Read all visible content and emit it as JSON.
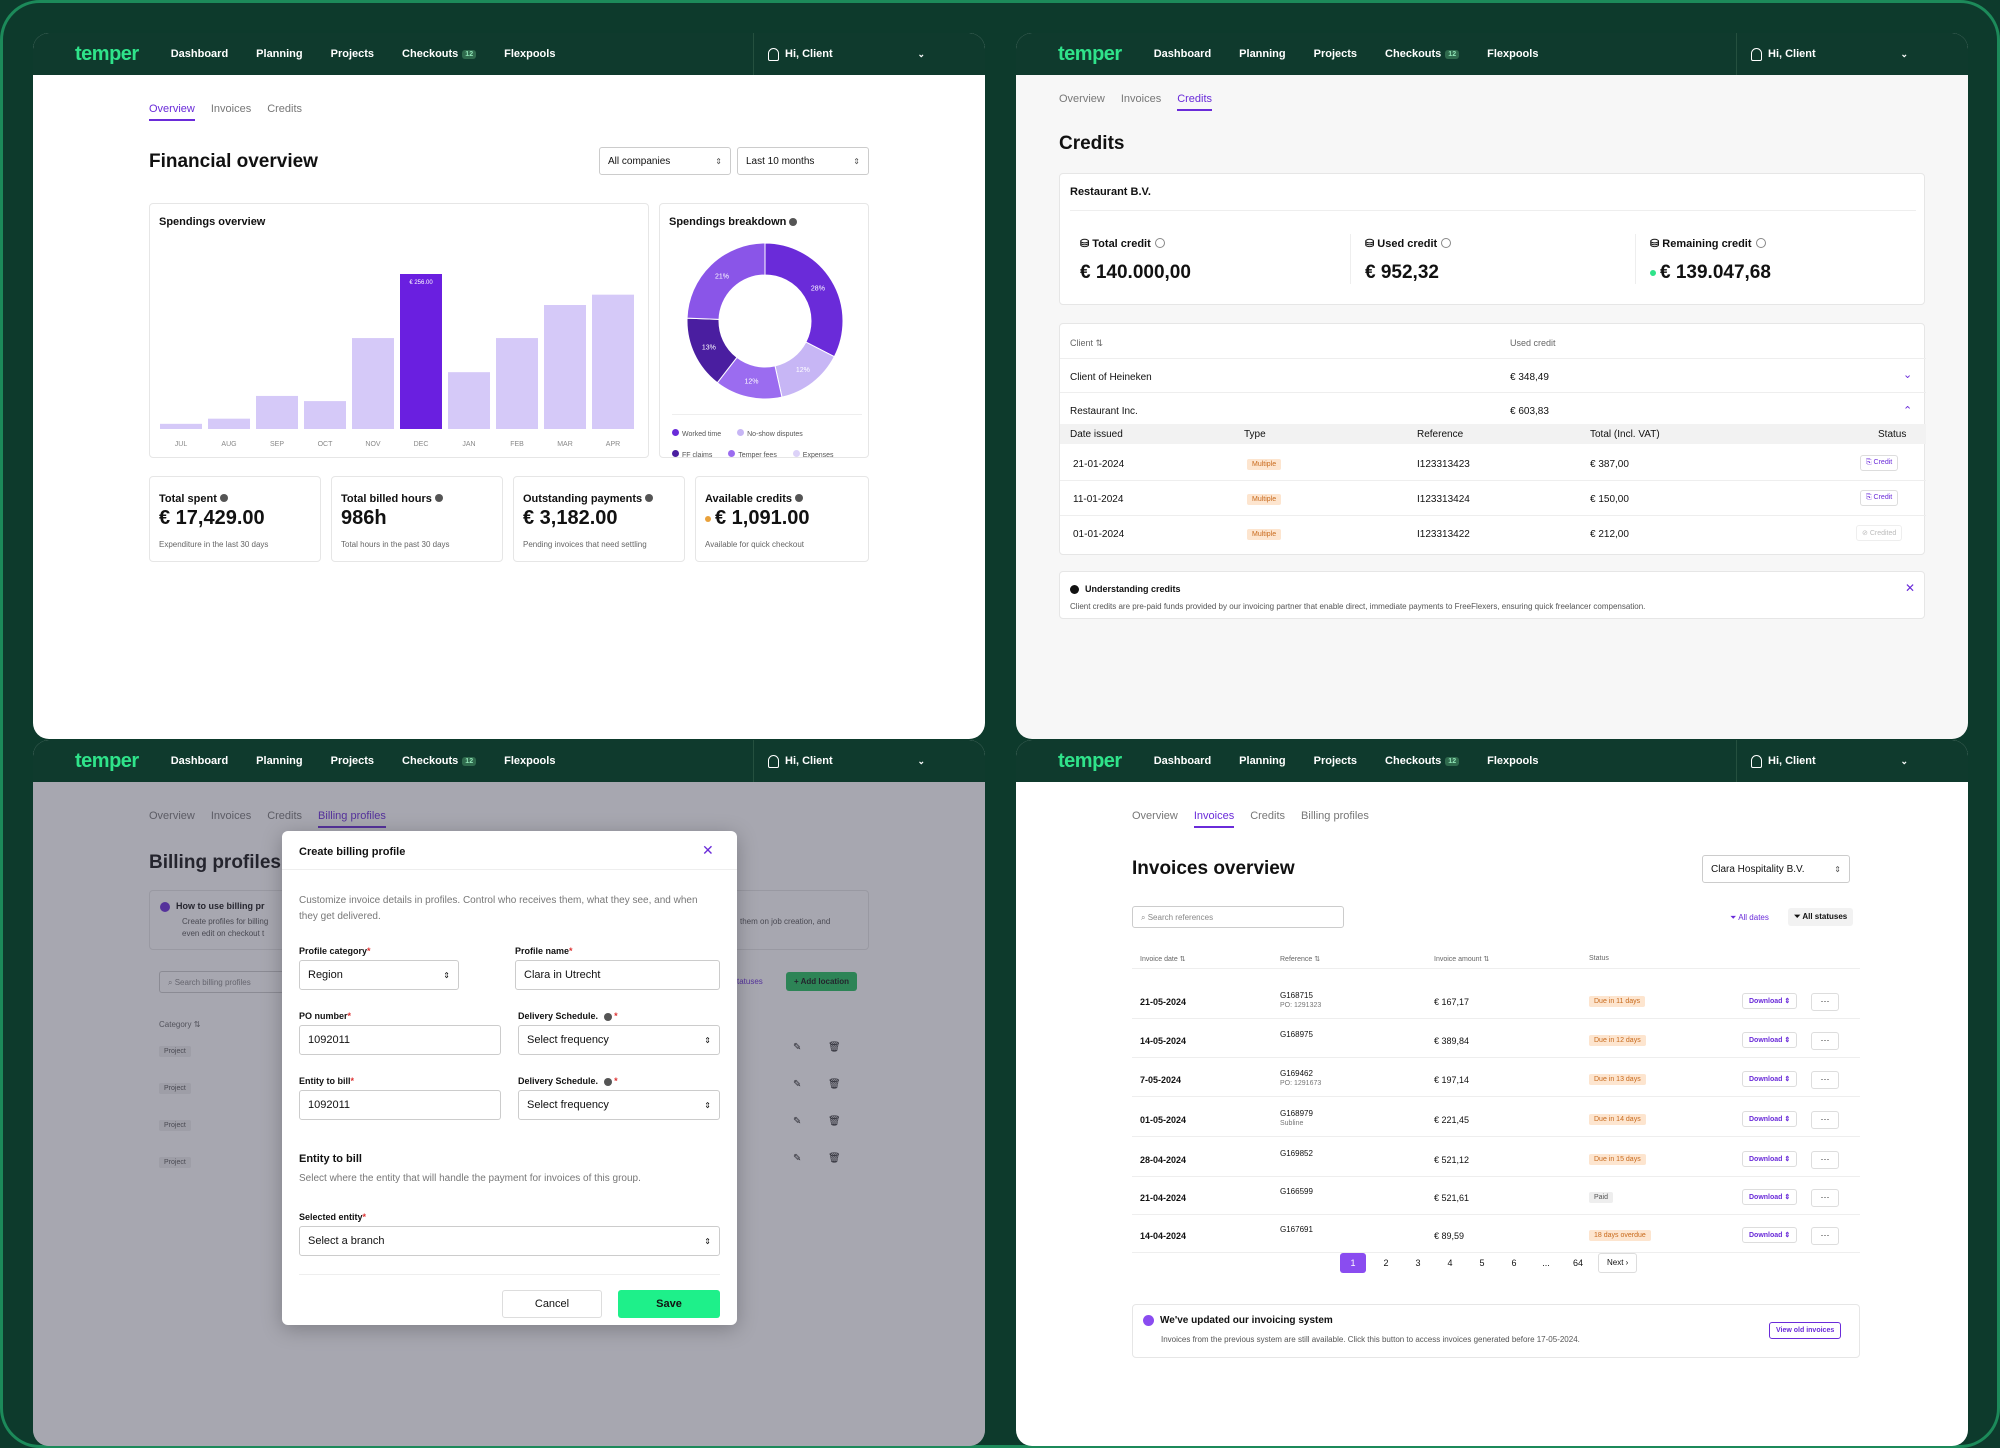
{
  "nav": {
    "logo": "temper",
    "items": [
      "Dashboard",
      "Planning",
      "Projects",
      "Checkouts",
      "Flexpools"
    ],
    "badge": "12",
    "user": "Hi, Client"
  },
  "p1": {
    "tabs": [
      "Overview",
      "Invoices",
      "Credits"
    ],
    "title": "Financial overview",
    "filter_company": "All companies",
    "filter_period": "Last 10 months",
    "spend_title": "Spendings overview",
    "breakdown_title": "Spendings breakdown",
    "legend": [
      "Worked time",
      "No-show disputes",
      "FF claims",
      "Temper fees",
      "Expenses"
    ],
    "stats": [
      {
        "label": "Total spent",
        "value": "€ 17,429.00",
        "sub": "Expenditure in the last 30 days"
      },
      {
        "label": "Total billed hours",
        "value": "986h",
        "sub": "Total hours in the past 30 days"
      },
      {
        "label": "Outstanding payments",
        "value": "€ 3,182.00",
        "sub": "Pending invoices that need settling"
      },
      {
        "label": "Available credits",
        "value": "€ 1,091.00",
        "sub": "Available for quick checkout"
      }
    ]
  },
  "chart_data": [
    {
      "type": "bar",
      "title": "Spendings overview",
      "categories": [
        "JUL",
        "AUG",
        "SEP",
        "OCT",
        "NOV",
        "DEC",
        "JAN",
        "FEB",
        "MAR",
        "APR"
      ],
      "values": [
        5,
        10,
        32,
        27,
        88,
        150,
        55,
        88,
        120,
        130
      ],
      "highlight_label": "€ 256.00",
      "ylim": [
        0,
        150
      ]
    },
    {
      "type": "pie",
      "title": "Spendings breakdown",
      "labels": [
        "Worked time",
        "No-show disputes",
        "FF claims",
        "Temper fees",
        "Expenses"
      ],
      "values": [
        28,
        12,
        12,
        13,
        21
      ],
      "colors": [
        "#6a2bd9",
        "#c7b6f5",
        "#9b6cf0",
        "#4a1ea0",
        "#8a55e8"
      ]
    }
  ],
  "p2": {
    "tabs": [
      "Overview",
      "Invoices",
      "Credits"
    ],
    "title": "Credits",
    "company": "Restaurant B.V.",
    "totals": [
      {
        "label": "Total credit",
        "value": "€ 140.000,00"
      },
      {
        "label": "Used credit",
        "value": "€ 952,32"
      },
      {
        "label": "Remaining credit",
        "value": "€ 139.047,68"
      }
    ],
    "col_client": "Client",
    "col_used": "Used credit",
    "clients": [
      {
        "name": "Client of Heineken",
        "used": "€  348,49"
      },
      {
        "name": "Restaurant Inc.",
        "used": "€  603,83"
      }
    ],
    "sub_headers": [
      "Date issued",
      "Type",
      "Reference",
      "Total (Incl. VAT)",
      "Status"
    ],
    "sub_rows": [
      {
        "date": "21-01-2024",
        "type": "Multiple",
        "ref": "I123313423",
        "total": "€  387,00",
        "status": "Credit"
      },
      {
        "date": "11-01-2024",
        "type": "Multiple",
        "ref": "I123313424",
        "total": "€ 150,00",
        "status": "Credit"
      },
      {
        "date": "01-01-2024",
        "type": "Multiple",
        "ref": "I123313422",
        "total": "€ 212,00",
        "status": "Credited"
      }
    ],
    "note_title": "Understanding credits",
    "note_text": "Client credits are pre-paid funds provided by our invoicing partner that enable direct, immediate payments to FreeFlexers, ensuring quick freelancer compensation."
  },
  "p3": {
    "tabs": [
      "Overview",
      "Invoices",
      "Credits",
      "Billing profiles"
    ],
    "title": "Billing profiles",
    "how_title": "How to use billing pr",
    "how_text1": "Create profiles for billing",
    "how_text2": "even edit on checkout t",
    "how_right": "them on job creation, and",
    "search": "Search billing profiles",
    "statuses": "statuses",
    "add": "Add location",
    "category": "Category",
    "rows": [
      "Project",
      "Project",
      "Project",
      "Project"
    ],
    "modal": {
      "title": "Create billing profile",
      "desc": "Customize invoice details in profiles. Control who receives them, what they see, and when they get delivered.",
      "lbl_cat": "Profile category",
      "val_cat": "Region",
      "lbl_name": "Profile name",
      "val_name": "Clara in Utrecht",
      "lbl_po": "PO number",
      "val_po": "1092011",
      "lbl_del": "Delivery Schedule.",
      "val_del": "Select frequency",
      "lbl_ent": "Entity to bill",
      "val_ent": "1092011",
      "lbl_del2": "Delivery Schedule.",
      "val_del2": "Select frequency",
      "sec_title": "Entity to bill",
      "sec_desc": "Select where the entity that will handle the payment for invoices of this group.",
      "lbl_sel": "Selected entity",
      "val_sel": "Select a branch",
      "cancel": "Cancel",
      "save": "Save"
    }
  },
  "p4": {
    "tabs": [
      "Overview",
      "Invoices",
      "Credits",
      "Billing profiles"
    ],
    "title": "Invoices overview",
    "company": "Clara Hospitality B.V.",
    "search": "Search references",
    "all_dates": "All dates",
    "all_statuses": "All statuses",
    "headers": [
      "Invoice date",
      "Reference",
      "Invoice amount",
      "Status"
    ],
    "rows": [
      {
        "date": "21-05-2024",
        "ref": "G168715",
        "sub": "PO: 1291323",
        "amt": "€ 167,17",
        "status": "Due in 11 days"
      },
      {
        "date": "14-05-2024",
        "ref": "G168975",
        "sub": "",
        "amt": "€ 389,84",
        "status": "Due in 12 days"
      },
      {
        "date": "7-05-2024",
        "ref": "G169462",
        "sub": "PO: 1291673",
        "amt": "€ 197,14",
        "status": "Due in 13 days"
      },
      {
        "date": "01-05-2024",
        "ref": "G168979",
        "sub": "Subline",
        "amt": "€ 221,45",
        "status": "Due in 14 days"
      },
      {
        "date": "28-04-2024",
        "ref": "G169852",
        "sub": "",
        "amt": "€ 521,12",
        "status": "Due in 15 days"
      },
      {
        "date": "21-04-2024",
        "ref": "G166599",
        "sub": "",
        "amt": "€ 521,61",
        "status": "Paid"
      },
      {
        "date": "14-04-2024",
        "ref": "G167691",
        "sub": "",
        "amt": "€ 89,59",
        "status": "18 days overdue"
      }
    ],
    "download": "Download",
    "more": "···",
    "pages": [
      "1",
      "2",
      "3",
      "4",
      "5",
      "6",
      "...",
      "64"
    ],
    "next": "Next",
    "update_title": "We've updated our invoicing system",
    "update_text": "Invoices from the previous system are still available. Click this button to access invoices generated before 17-05-2024.",
    "view_old": "View old invoices"
  }
}
